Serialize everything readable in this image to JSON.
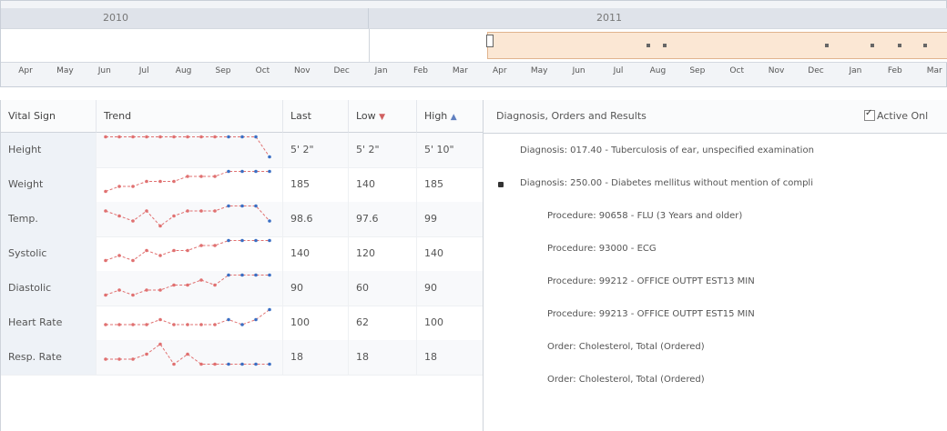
{
  "timeline": {
    "years": [
      "2010",
      "2011"
    ],
    "months": [
      "Apr",
      "May",
      "Jun",
      "Jul",
      "Aug",
      "Sep",
      "Oct",
      "Nov",
      "Dec",
      "Jan",
      "Feb",
      "Mar",
      "Apr",
      "May",
      "Jun",
      "Jul",
      "Aug",
      "Sep",
      "Oct",
      "Nov",
      "Dec",
      "Jan",
      "Feb",
      "Mar"
    ]
  },
  "vitals": {
    "headers": {
      "sign": "Vital Sign",
      "trend": "Trend",
      "last": "Last",
      "low": "Low",
      "high": "High"
    },
    "rows": [
      {
        "name": "Height",
        "last": "5' 2\"",
        "low": "5' 2\"",
        "high": "5' 10\"",
        "trend": [
          5,
          5,
          5,
          5,
          5,
          5,
          5,
          5,
          5,
          5,
          5,
          5,
          1
        ]
      },
      {
        "name": "Weight",
        "last": "185",
        "low": "140",
        "high": "185",
        "trend": [
          1,
          2,
          2,
          3,
          3,
          3,
          4,
          4,
          4,
          5,
          5,
          5,
          5
        ]
      },
      {
        "name": "Temp.",
        "last": "98.6",
        "low": "97.6",
        "high": "99",
        "trend": [
          4,
          3,
          2,
          4,
          1,
          3,
          4,
          4,
          4,
          5,
          5,
          5,
          2
        ]
      },
      {
        "name": "Systolic",
        "last": "140",
        "low": "120",
        "high": "140",
        "trend": [
          1,
          2,
          1,
          3,
          2,
          3,
          3,
          4,
          4,
          5,
          5,
          5,
          5
        ]
      },
      {
        "name": "Diastolic",
        "last": "90",
        "low": "60",
        "high": "90",
        "trend": [
          1,
          2,
          1,
          2,
          2,
          3,
          3,
          4,
          3,
          5,
          5,
          5,
          5
        ]
      },
      {
        "name": "Heart Rate",
        "last": "100",
        "low": "62",
        "high": "100",
        "trend": [
          2,
          2,
          2,
          2,
          3,
          2,
          2,
          2,
          2,
          3,
          2,
          3,
          5
        ]
      },
      {
        "name": "Resp. Rate",
        "last": "18",
        "low": "18",
        "high": "18",
        "trend": [
          2,
          2,
          2,
          3,
          5,
          1,
          3,
          1,
          1,
          1,
          1,
          1,
          1
        ]
      }
    ]
  },
  "dx": {
    "title": "Diagnosis, Orders and Results",
    "active_label": "Active Onl",
    "items": [
      "Diagnosis: 017.40 - Tuberculosis of ear, unspecified examination",
      "Diagnosis: 250.00 - Diabetes mellitus without mention of compli",
      "Procedure: 90658 - FLU (3 Years and older)",
      "Procedure: 93000 - ECG",
      "Procedure: 99212 - OFFICE OUTPT EST13 MIN",
      "Procedure: 99213 - OFFICE OUTPT EST15 MIN",
      "Order: Cholesterol, Total (Ordered)",
      "Order: Cholesterol, Total (Ordered)"
    ]
  },
  "colors": {
    "accent": "#3a6fc4",
    "trend_line": "#e07070",
    "range": "#fbe7d4"
  }
}
